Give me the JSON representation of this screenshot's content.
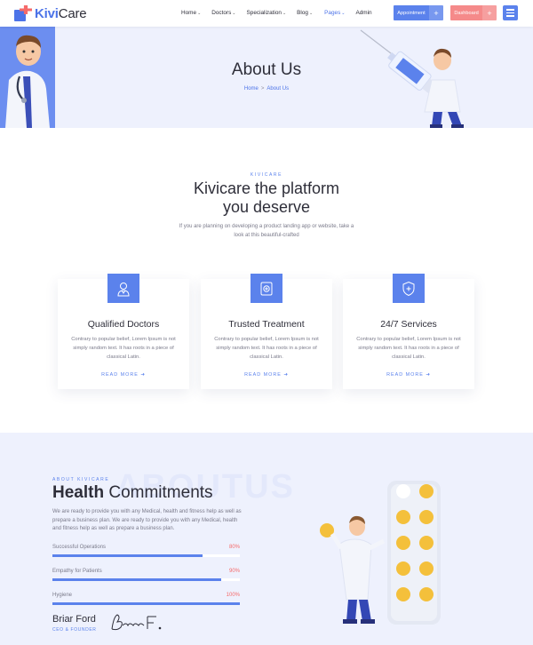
{
  "brand": {
    "name_a": "Kivi",
    "name_b": "Care"
  },
  "nav": {
    "items": [
      {
        "label": "Home",
        "dropdown": true,
        "active": false
      },
      {
        "label": "Doctors",
        "dropdown": true,
        "active": false
      },
      {
        "label": "Specialization",
        "dropdown": true,
        "active": false
      },
      {
        "label": "Blog",
        "dropdown": true,
        "active": false
      },
      {
        "label": "Pages",
        "dropdown": true,
        "active": true
      },
      {
        "label": "Admin",
        "dropdown": false,
        "active": false
      }
    ],
    "appointment_label": "Appointment",
    "dashboard_label": "Dashboard",
    "plus": "+"
  },
  "banner": {
    "title": "About Us",
    "breadcrumb_home": "Home",
    "breadcrumb_sep": ">",
    "breadcrumb_current": "About Us"
  },
  "intro": {
    "kicker": "KIVICARE",
    "headline_line1": "Kivicare the platform",
    "headline_line2": "you deserve",
    "text": "If you are planning on developing a product landing app or website, take a look at this beautiful-crafted"
  },
  "cards": [
    {
      "icon": "doctor-icon",
      "title": "Qualified Doctors",
      "text": "Contrary to popular belief, Lorem Ipsum is not simply random text. It has roots in a piece of classical Latin.",
      "link": "READ MORE"
    },
    {
      "icon": "treatment-icon",
      "title": "Trusted Treatment",
      "text": "Contrary to popular belief, Lorem Ipsum is not simply random text. It has roots in a piece of classical Latin.",
      "link": "READ MORE"
    },
    {
      "icon": "shield-plus-icon",
      "title": "24/7 Services",
      "text": "Contrary to popular belief, Lorem Ipsum is not simply random text. It has roots in a piece of classical Latin.",
      "link": "READ MORE"
    }
  ],
  "about": {
    "bg_word": "ABOUTUS",
    "kicker": "ABOUT KIVICARE",
    "title_bold": "Health",
    "title_rest": " Commitments",
    "text": "We are ready to provide you with any Medical, health and fitness help as well as prepare a business plan. We are ready to provide you with any Medical, health and fitness help as well as prepare a business plan.",
    "skills": [
      {
        "label": "Successful Operations",
        "percent_text": "80%",
        "value": 80
      },
      {
        "label": "Empathy for Patients",
        "percent_text": "90%",
        "value": 90
      },
      {
        "label": "Hygiene",
        "percent_text": "100%",
        "value": 100
      }
    ],
    "signature_name": "Briar Ford",
    "signature_role": "CEO & FOUNDER",
    "signature_hand": "Brandon F."
  },
  "colors": {
    "primary": "#5b82ec",
    "accent": "#f56a6a",
    "banner_bg": "#eef1fd",
    "dark": "#2e2e39"
  }
}
